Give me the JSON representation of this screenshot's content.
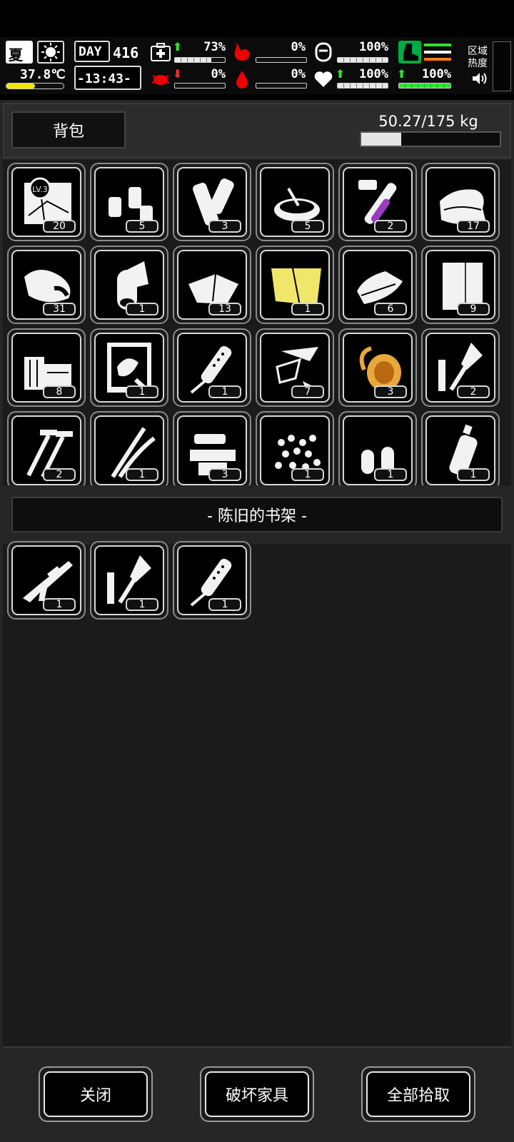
{
  "hud": {
    "season": "夏",
    "temperature": "37.8℃",
    "day_label": "DAY",
    "day_number": "416",
    "time": "-13:43-",
    "health_pct": "73%",
    "hunger_pct": "0%",
    "food_pct": "100%",
    "infection_pct": "0%",
    "bleed_pct": "0%",
    "mood_pct": "100%",
    "stamina_pct": "100%",
    "health_fill": 0.73,
    "food_fill": 1.0,
    "mood_fill": 1.0,
    "stamina_fill": 1.0,
    "zone_heat_line1": "区域",
    "zone_heat_line2": "热度"
  },
  "backpack": {
    "tab_label": "背包",
    "weight_text": "50.27/175 kg",
    "weight_fill": 0.287,
    "items": [
      {
        "icon": "map-icon",
        "count": "20"
      },
      {
        "icon": "bottles-icon",
        "count": "5"
      },
      {
        "icon": "bandage-roll-icon",
        "count": "3"
      },
      {
        "icon": "bowl-icon",
        "count": "5"
      },
      {
        "icon": "test-tube-icon",
        "count": "2"
      },
      {
        "icon": "cloth-pile-icon",
        "count": "17"
      },
      {
        "icon": "meat-icon",
        "count": "31"
      },
      {
        "icon": "paper-roll-icon",
        "count": "1"
      },
      {
        "icon": "cloth-sheet-icon",
        "count": "13"
      },
      {
        "icon": "yellow-cloth-icon",
        "count": "1"
      },
      {
        "icon": "towel-icon",
        "count": "6"
      },
      {
        "icon": "paper-sheet-icon",
        "count": "9"
      },
      {
        "icon": "wood-planks-icon",
        "count": "8"
      },
      {
        "icon": "blueprint-icon",
        "count": "1"
      },
      {
        "icon": "scope-icon",
        "count": "1"
      },
      {
        "icon": "glass-shards-icon",
        "count": "7"
      },
      {
        "icon": "rope-coil-icon",
        "count": "3"
      },
      {
        "icon": "rocket-part-icon",
        "count": "2"
      },
      {
        "icon": "screws-icon",
        "count": "2"
      },
      {
        "icon": "wires-icon",
        "count": "1"
      },
      {
        "icon": "gun-parts-icon",
        "count": "3"
      },
      {
        "icon": "pellets-icon",
        "count": "1"
      },
      {
        "icon": "bullets-icon",
        "count": "1"
      },
      {
        "icon": "plastic-bottle-icon",
        "count": "1"
      }
    ]
  },
  "container": {
    "title": "- 陈旧的书架 -",
    "items": [
      {
        "icon": "rifle-icon",
        "count": "1"
      },
      {
        "icon": "rocket-part-icon",
        "count": "1"
      },
      {
        "icon": "scope-icon",
        "count": "1"
      }
    ]
  },
  "footer": {
    "close_label": "关闭",
    "destroy_label": "破坏家具",
    "pickup_all_label": "全部拾取"
  }
}
